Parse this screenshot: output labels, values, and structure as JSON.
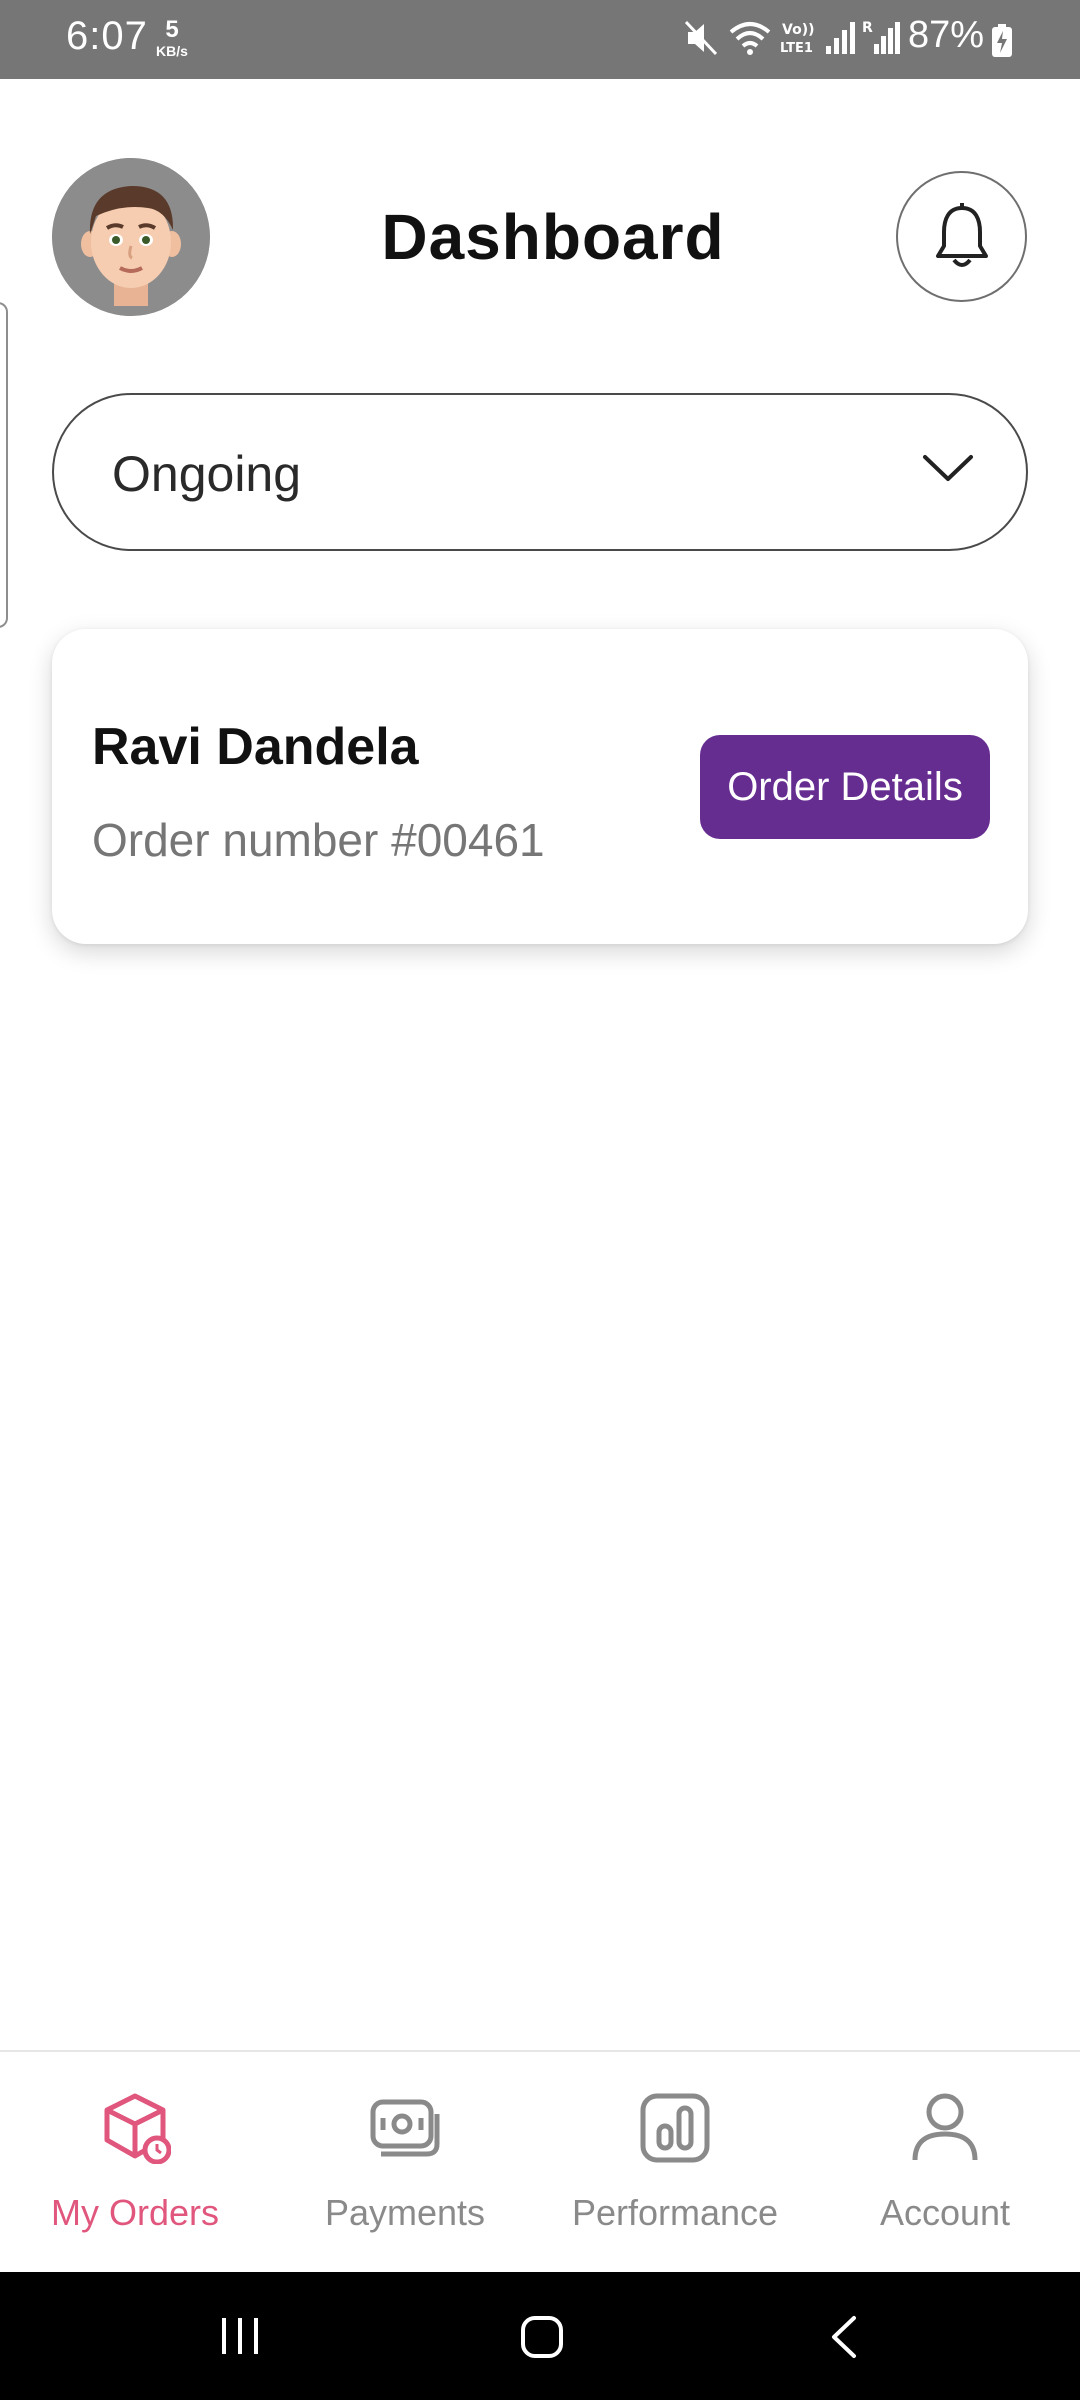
{
  "status_bar": {
    "time": "6:07",
    "net_speed_value": "5",
    "net_speed_unit": "KB/s",
    "volte_label": "Vo)) LTE1",
    "roaming_label": "R",
    "battery": "87%"
  },
  "header": {
    "title": "Dashboard",
    "avatar_icon": "memoji-avatar",
    "bell_icon": "bell-icon"
  },
  "filter": {
    "selected": "Ongoing",
    "icon": "chevron-down-icon"
  },
  "orders": [
    {
      "customer": "Ravi Dandela",
      "order_number": "Order number #00461",
      "action_label": "Order Details",
      "action_color": "#662d91"
    }
  ],
  "bottom_nav": {
    "active_color": "#e0567d",
    "inactive_color": "#8a8a8a",
    "items": [
      {
        "label": "My Orders",
        "icon": "box-icon",
        "active": true
      },
      {
        "label": "Payments",
        "icon": "cash-icon",
        "active": false
      },
      {
        "label": "Performance",
        "icon": "bar-chart-icon",
        "active": false
      },
      {
        "label": "Account",
        "icon": "person-icon",
        "active": false
      }
    ]
  },
  "system_nav": {
    "recents_icon": "recents-icon",
    "home_icon": "home-icon",
    "back_icon": "back-icon"
  }
}
